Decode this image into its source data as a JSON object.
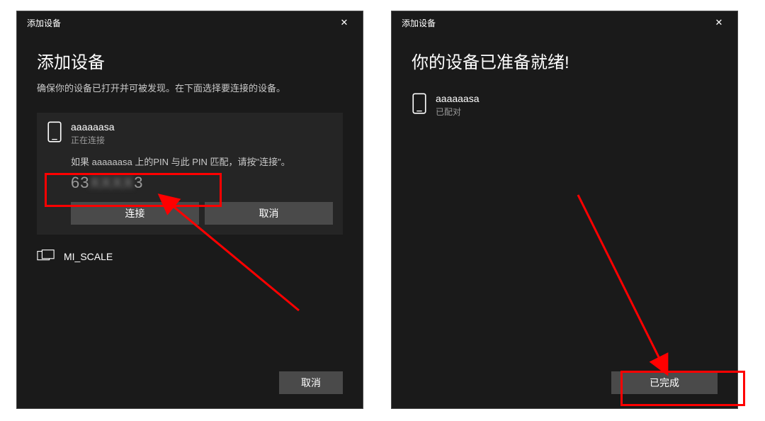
{
  "dialogLeft": {
    "titlebar": "添加设备",
    "heading": "添加设备",
    "subtext": "确保你的设备已打开并可被发现。在下面选择要连接的设备。",
    "device": {
      "name": "aaaaaasa",
      "status": "正在连接",
      "pinMessage": "如果 aaaaaasa 上的PIN 与此 PIN 匹配，请按\"连接\"。",
      "pinVisiblePrefix": "63",
      "pinHidden": "XXXX",
      "pinVisibleSuffix": "3"
    },
    "buttons": {
      "connect": "连接",
      "cancel": "取消"
    },
    "otherDevice": "MI_SCALE",
    "footerCancel": "取消"
  },
  "dialogRight": {
    "titlebar": "添加设备",
    "heading": "你的设备已准备就绪!",
    "device": {
      "name": "aaaaaasa",
      "status": "已配对"
    },
    "footerDone": "已完成"
  },
  "icons": {
    "close": "✕",
    "phone": "phone-icon",
    "monitor": "monitor-icon"
  },
  "annotationColor": "#ff0000"
}
